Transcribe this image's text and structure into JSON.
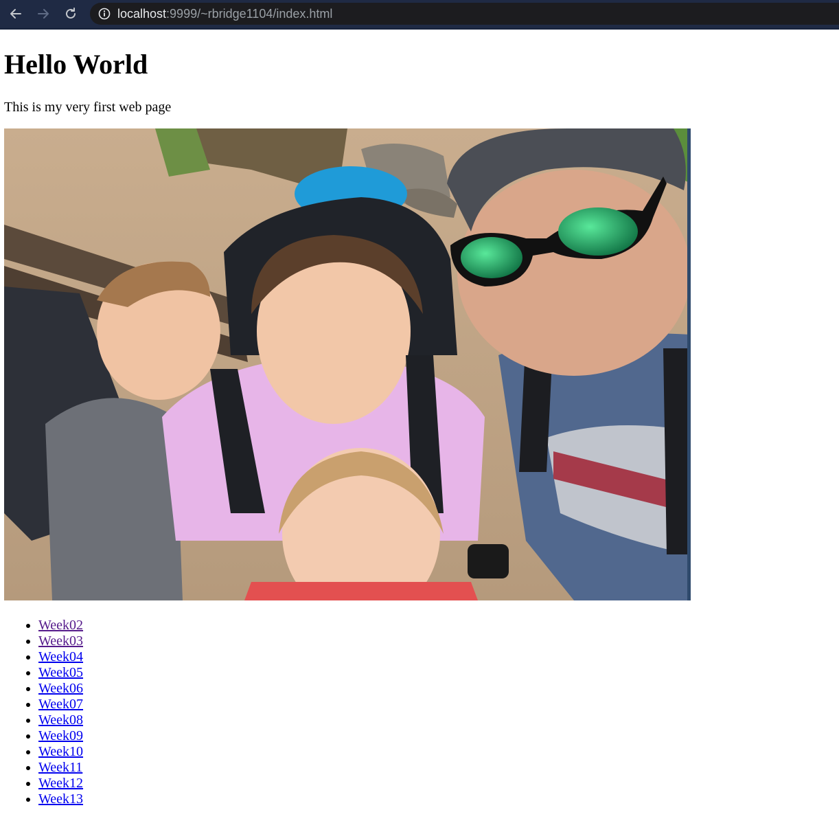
{
  "browser": {
    "url_host": "localhost",
    "url_rest": ":9999/~rbridge1104/index.html"
  },
  "page": {
    "heading": "Hello World",
    "intro": "This is my very first web page",
    "photo_description": "family-selfie-photo"
  },
  "links": [
    {
      "label": "Week02",
      "visited": true
    },
    {
      "label": "Week03",
      "visited": true
    },
    {
      "label": "Week04",
      "visited": false
    },
    {
      "label": "Week05",
      "visited": false
    },
    {
      "label": "Week06",
      "visited": false
    },
    {
      "label": "Week07",
      "visited": false
    },
    {
      "label": "Week08",
      "visited": false
    },
    {
      "label": "Week09",
      "visited": false
    },
    {
      "label": "Week10",
      "visited": false
    },
    {
      "label": "Week11",
      "visited": false
    },
    {
      "label": "Week12",
      "visited": false
    },
    {
      "label": "Week13",
      "visited": false
    }
  ],
  "colors": {
    "link": "#0000ee",
    "visited_link": "#551a8b",
    "browser_bar": "#1f2a44"
  }
}
